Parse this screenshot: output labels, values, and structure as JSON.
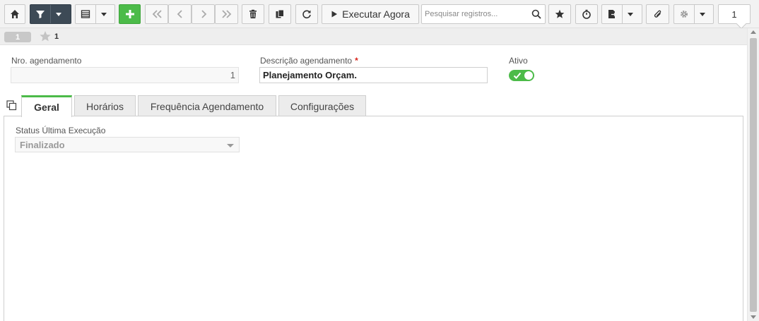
{
  "toolbar": {
    "execute_label": "Executar Agora",
    "search_placeholder": "Pesquisar registros...",
    "page_number": "1",
    "icons": [
      "home-icon",
      "filter-icon",
      "list-view-icon",
      "plus-icon",
      "first-icon",
      "previous-icon",
      "next-icon",
      "last-icon",
      "trash-icon",
      "copy-icon",
      "refresh-icon",
      "play-icon",
      "search-icon",
      "star-icon",
      "stopwatch-icon",
      "export-icon",
      "paperclip-icon",
      "gear-icon"
    ],
    "colors": {
      "dark": "#3d4a56",
      "green": "#4cbb49"
    }
  },
  "record": {
    "number": "1",
    "favorite_count": "1"
  },
  "form": {
    "nro_label": "Nro. agendamento",
    "nro_value": "1",
    "descricao_label": "Descrição agendamento",
    "required_mark": "*",
    "descricao_value": "Planejamento Orçam.",
    "ativo_label": "Ativo",
    "ativo_on": true
  },
  "tabs": [
    {
      "label": "Geral",
      "active": true
    },
    {
      "label": "Horários",
      "active": false
    },
    {
      "label": "Frequência Agendamento",
      "active": false
    },
    {
      "label": "Configurações",
      "active": false
    }
  ],
  "geral": {
    "status_label": "Status Última Execução",
    "status_value": "Finalizado"
  }
}
